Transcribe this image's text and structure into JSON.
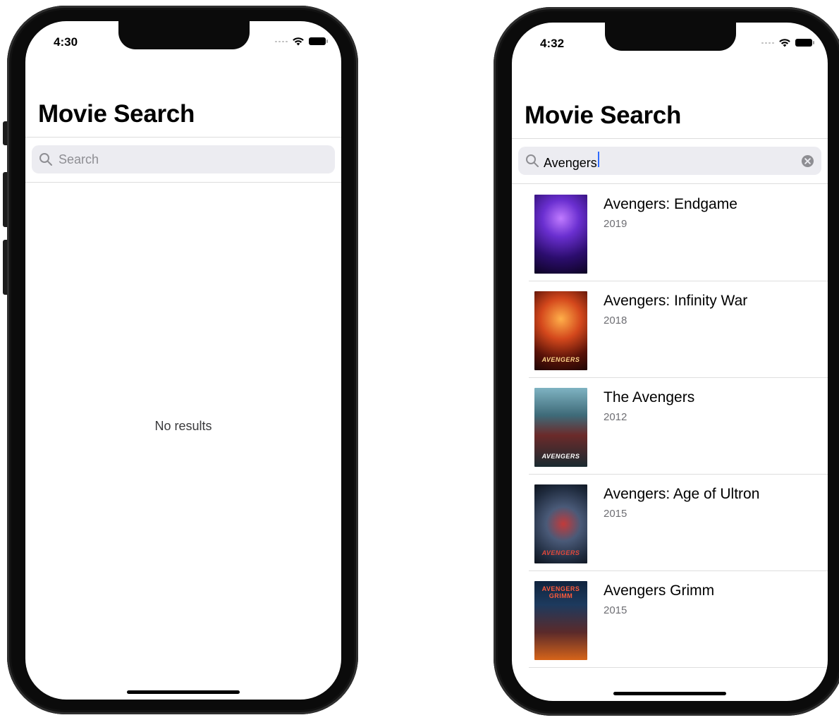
{
  "left_screen": {
    "time": "4:30",
    "title": "Movie Search",
    "search_placeholder": "Search",
    "empty_message": "No results"
  },
  "right_screen": {
    "time": "4:32",
    "title": "Movie Search",
    "search_query": "Avengers",
    "results": [
      {
        "title": "Avengers: Endgame",
        "year": "2019",
        "poster_label": ""
      },
      {
        "title": "Avengers: Infinity War",
        "year": "2018",
        "poster_label": "AVENGERS"
      },
      {
        "title": "The Avengers",
        "year": "2012",
        "poster_label": "AVENGERS"
      },
      {
        "title": "Avengers: Age of Ultron",
        "year": "2015",
        "poster_label": "AVENGERS"
      },
      {
        "title": "Avengers Grimm",
        "year": "2015",
        "poster_label": "AVENGERS GRIMM"
      }
    ]
  },
  "icons": {
    "search": "search-icon",
    "wifi": "wifi-icon",
    "battery": "battery-icon",
    "clear": "clear-icon"
  },
  "colors": {
    "search_field_bg": "#ececf1",
    "caret": "#2f6bff",
    "secondary_text": "#6e6e73"
  }
}
